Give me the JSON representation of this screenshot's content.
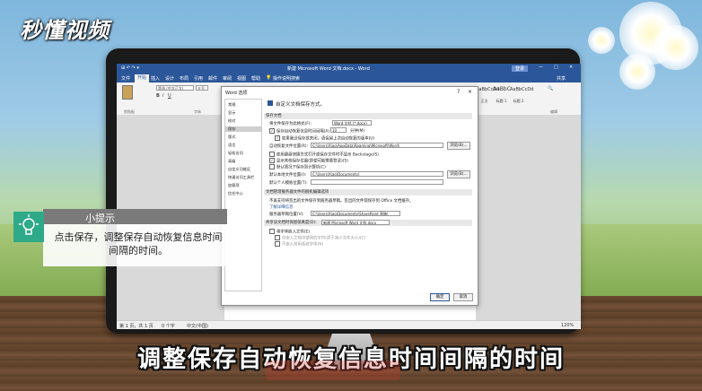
{
  "brand": {
    "logo_text": "秒懂视频",
    "watermark": "Baidu 经验"
  },
  "word": {
    "title": "新建 Microsoft Word 文档.docx - Word",
    "signin": "登录",
    "quick_access": "⊞ ↶ ↷ ▾",
    "tabs": [
      "文件",
      "开始",
      "插入",
      "设计",
      "布局",
      "引用",
      "邮件",
      "审阅",
      "视图",
      "帮助",
      "操作说明搜索"
    ],
    "share": "共享",
    "font_name": "等线 (中文正文)",
    "font_size": "五号",
    "clipboard_label": "剪贴板",
    "font_group_label": "字体",
    "editing_label": "编辑",
    "styles": [
      "AaBbCcDd",
      "AaBbC",
      "AaBbCcDd"
    ],
    "style_names": [
      "正文",
      "标题 1",
      "标题 2"
    ],
    "status": {
      "page": "第 1 页，共 1 页",
      "words": "0 个字",
      "language": "中文(中国)",
      "zoom": "120%"
    }
  },
  "dialog": {
    "title": "Word 选项",
    "help": "?",
    "close": "×",
    "nav": [
      "常规",
      "显示",
      "校对",
      "保存",
      "版式",
      "语言",
      "轻松访问",
      "高级",
      "自定义功能区",
      "快速访问工具栏",
      "加载项",
      "信任中心"
    ],
    "selected_nav": "保存",
    "header": "自定义文档保存方式。",
    "sections": {
      "save_docs": "保存文档",
      "offline": "文档管理服务器文件的脱机编辑选项",
      "fidelity": "共享该文档时保留保真度(D):"
    },
    "format_label": "将文件保存为此格式(F):",
    "format_value": "Word 文档 (*.docx)",
    "autorecover_label": "保存自动恢复信息时间间隔(A)",
    "autorecover_minutes": "10",
    "minutes_unit": "分钟(M)",
    "keep_last_label": "如果我没保存就关闭，请保留上次自动恢复的版本(U)",
    "autorecover_path_label": "自动恢复文件位置(R):",
    "autorecover_path": "C:\\Users\\Xiao\\AppData\\Roaming\\Microsoft\\Word\\",
    "browse1": "浏览(B)...",
    "backstage_label": "使用键盘快捷方式打开或保存文件时不显示 Backstage(S)",
    "show_more_label": "显示其他保存位置(即使可能需要登录)(S)",
    "default_pc_label": "默认情况下保存到计算机(C)",
    "local_path_label": "默认本地文件位置(I):",
    "local_path": "C:\\Users\\Xiao\\Documents\\",
    "browse2": "浏览(B)...",
    "template_label": "默认个人模板位置(T):",
    "offline_desc": "不再支持将签出的文件保存到服务器草稿。签出的文件现保存到 Office 文档缓存。",
    "offline_link": "了解详细信息",
    "server_draft_label": "服务器草稿位置(V):",
    "server_draft_path": "C:\\Users\\Xiao\\Documents\\SharePoint 草稿\\",
    "fidelity_doc": "新建 Microsoft Word 文档.docx",
    "embed_fonts_label": "将字体嵌入文件(E)",
    "embed_only_used": "仅嵌入文档中使用的字符(适于减小文件大小)(C)",
    "no_common_fonts": "不嵌入常用系统字体(N)",
    "ok": "确定",
    "cancel": "取消"
  },
  "tip": {
    "title": "小提示",
    "text": "点击保存，调整保存自动恢复信息时间间隔的时间。"
  },
  "subtitle": "调整保存自动恢复信息时间间隔的时间"
}
